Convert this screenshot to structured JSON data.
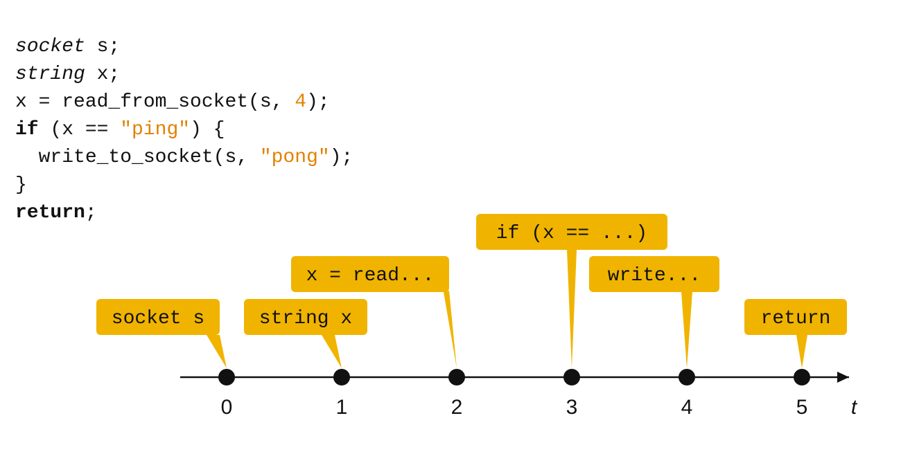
{
  "code": {
    "l1_type": "socket",
    "l1_rest": " s;",
    "l2_type": "string",
    "l2_rest": " x;",
    "l3_lhs": "x = read_from_socket(s, ",
    "l3_lit": "4",
    "l3_rhs": ");",
    "l4_kw": "if",
    "l4_a": " (x == ",
    "l4_lit": "\"ping\"",
    "l4_b": ") {",
    "l5_a": "  write_to_socket(s, ",
    "l5_lit": "\"pong\"",
    "l5_b": ");",
    "l6": "}",
    "l7_kw": "return",
    "l7_b": ";"
  },
  "axis": {
    "ticks": [
      "0",
      "1",
      "2",
      "3",
      "4",
      "5"
    ],
    "var": "t"
  },
  "callouts": {
    "c0": "socket s",
    "c1": "string x",
    "c2": "x = read...",
    "c3": "if (x == ...)",
    "c4": "write...",
    "c5": "return"
  }
}
